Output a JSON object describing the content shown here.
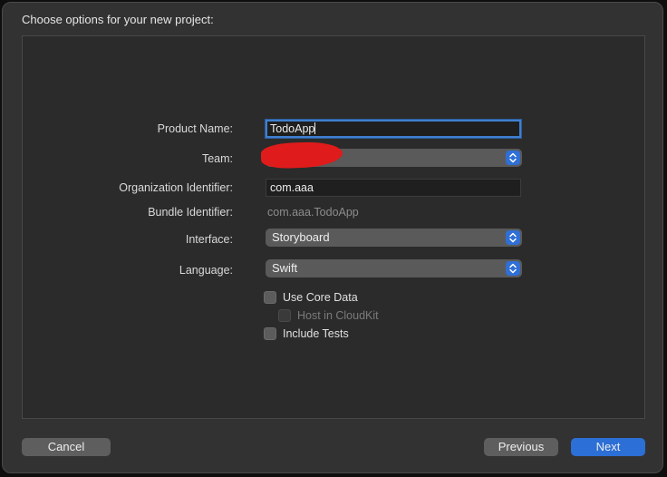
{
  "dialog": {
    "title": "Choose options for your new project:"
  },
  "form": {
    "product_name": {
      "label": "Product Name:",
      "value": "TodoApp"
    },
    "team": {
      "label": "Team:"
    },
    "organization_identifier": {
      "label": "Organization Identifier:",
      "value": "com.aaa"
    },
    "bundle_identifier": {
      "label": "Bundle Identifier:",
      "value": "com.aaa.TodoApp"
    },
    "interface": {
      "label": "Interface:",
      "value": "Storyboard"
    },
    "language": {
      "label": "Language:",
      "value": "Swift"
    }
  },
  "options": {
    "use_core_data": {
      "label": "Use Core Data",
      "checked": false,
      "enabled": true
    },
    "host_in_cloudkit": {
      "label": "Host in CloudKit",
      "checked": false,
      "enabled": false
    },
    "include_tests": {
      "label": "Include Tests",
      "checked": false,
      "enabled": true
    }
  },
  "buttons": {
    "cancel": "Cancel",
    "previous": "Previous",
    "next": "Next"
  },
  "colors": {
    "accent": "#2c6fd6",
    "redaction": "#e01b1b"
  },
  "icons": {
    "popup_arrows": "chevron-up-down-icon"
  }
}
